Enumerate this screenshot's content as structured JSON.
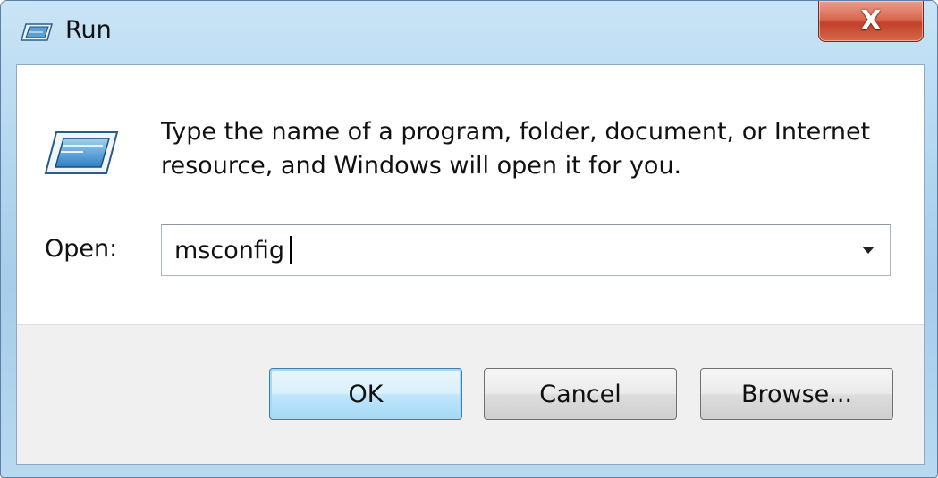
{
  "window": {
    "title": "Run",
    "close_label": "X"
  },
  "dialog": {
    "prompt_line1": "Type the name of a program, folder, document, or Internet",
    "prompt_line2": "resource, and Windows will open it for you.",
    "open_label": "Open:",
    "open_value": "msconfig",
    "open_placeholder": ""
  },
  "buttons": {
    "ok": "OK",
    "cancel": "Cancel",
    "browse": "Browse..."
  },
  "icons": {
    "title": "run-icon",
    "main": "run-icon",
    "dropdown": "chevron-down-icon"
  },
  "colors": {
    "frame": "#b3d6ef",
    "close": "#c1402a",
    "default_button_border": "#3c7fb1"
  }
}
